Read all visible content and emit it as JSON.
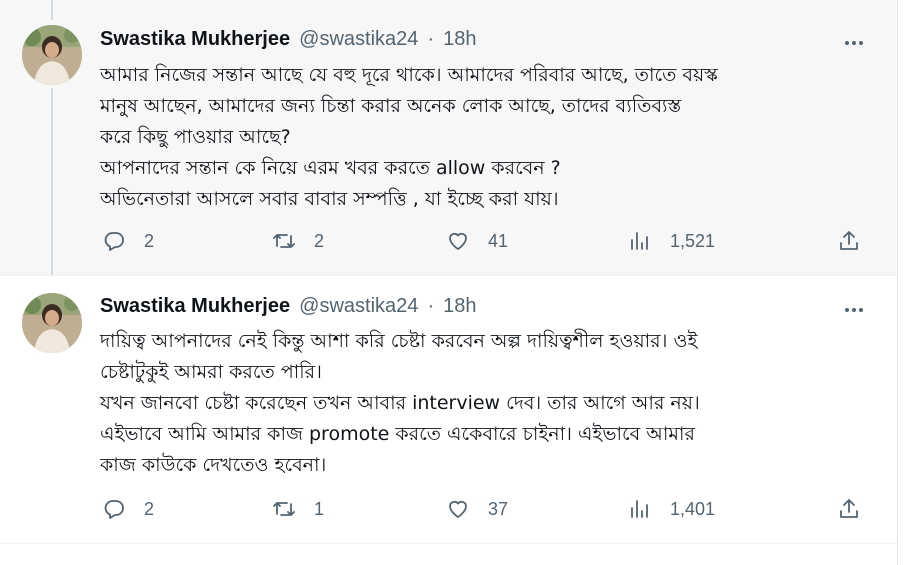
{
  "tweets": [
    {
      "author_name": "Swastika Mukherjee",
      "handle": "@swastika24",
      "separator": "·",
      "time": "18h",
      "lines": [
        "আমার নিজের সন্তান আছে যে বহু দূরে থাকে। আমাদের পরিবার আছে, তাতে বয়স্ক",
        "মানুষ আছেন, আমাদের জন্য চিন্তা করার অনেক লোক আছে, তাদের ব্যতিব্যস্ত",
        "করে কিছু পাওয়ার আছে?",
        "আপনাদের সন্তান কে নিয়ে এরম খবর করতে allow করবেন ?",
        "অভিনেতারা আসলে সবার বাবার সম্পত্তি , যা ইচ্ছে করা যায়।"
      ],
      "replies": "2",
      "retweets": "2",
      "likes": "41",
      "views": "1,521"
    },
    {
      "author_name": "Swastika Mukherjee",
      "handle": "@swastika24",
      "separator": "·",
      "time": "18h",
      "lines": [
        "দায়িত্ব আপনাদের নেই কিন্তু আশা করি চেষ্টা করবেন অল্প দায়িত্বশীল হওয়ার। ওই",
        "চেষ্টাটুকুই আমরা করতে পারি।",
        "যখন জানবো চেষ্টা করেছেন তখন আবার interview দেব। তার আগে আর নয়।",
        "এইভাবে আমি আমার কাজ promote করতে একেবারে চাইনা। এইভাবে আমার",
        "কাজ কাউকে দেখতেও হবেনা।"
      ],
      "replies": "2",
      "retweets": "1",
      "likes": "37",
      "views": "1,401"
    }
  ],
  "icons": {
    "reply": "reply-icon",
    "retweet": "retweet-icon",
    "like": "heart-icon",
    "views": "views-icon",
    "share": "share-icon",
    "more": "more-icon"
  },
  "colors": {
    "text": "#0f1419",
    "muted": "#536471",
    "thread_line": "#cfd9de",
    "highlight_bg": "#f7f7f7"
  }
}
